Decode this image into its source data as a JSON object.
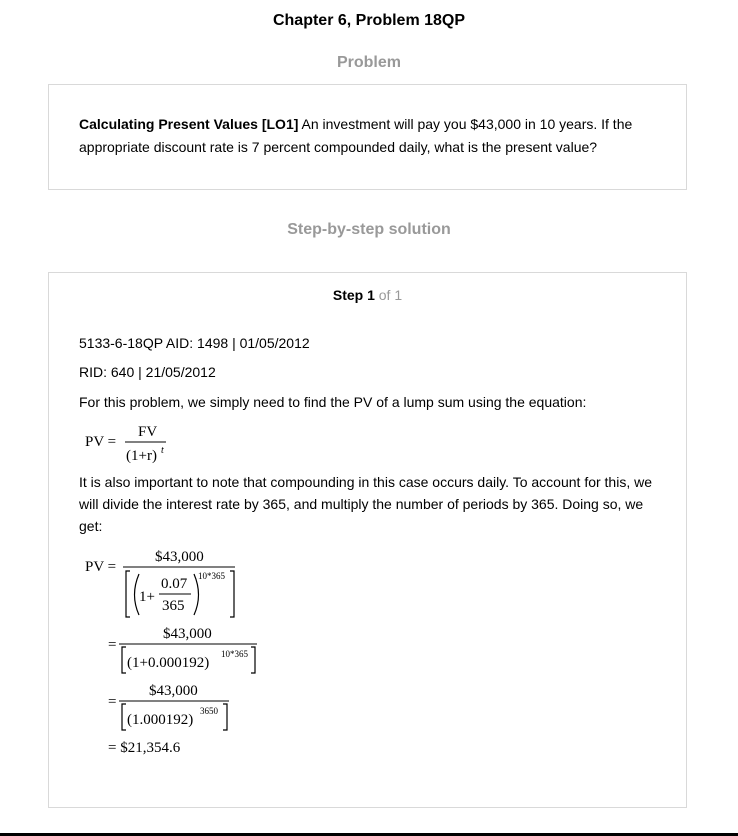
{
  "page": {
    "title": "Chapter 6, Problem 18QP"
  },
  "problem": {
    "heading": "Problem",
    "label": "Calculating Present Values [LO1]",
    "text": " An investment will pay you $43,000 in 10 years. If the appropriate discount rate is 7 percent compounded daily, what is the present value?"
  },
  "solution": {
    "heading": "Step-by-step solution",
    "step_label": "Step 1",
    "step_of": " of 1",
    "meta_line1": "5133-6-18QP AID: 1498 | 01/05/2012",
    "meta_line2": "RID: 640 | 21/05/2012",
    "intro": "For this problem, we simply need to find the PV of a lump sum using the equation:",
    "note": "It is also important to note that compounding in this case occurs daily. To account for this, we will divide the interest rate by 365, and multiply the number of periods by 365. Doing so, we get:"
  },
  "formula1": {
    "lhs": "PV =",
    "numerator": "FV",
    "denominator": "(1+r)",
    "exponent": "t"
  },
  "formula2": {
    "lhs": "PV =",
    "eq": "=",
    "numerator": "$43,000",
    "one_plus": "1+",
    "rate_num": "0.07",
    "rate_den": "365",
    "exp1": "10*365",
    "step2_base": "(1+0.000192)",
    "exp2": "10*365",
    "step3_base": "(1.000192)",
    "exp3": "3650",
    "result": "= $21,354.6"
  }
}
